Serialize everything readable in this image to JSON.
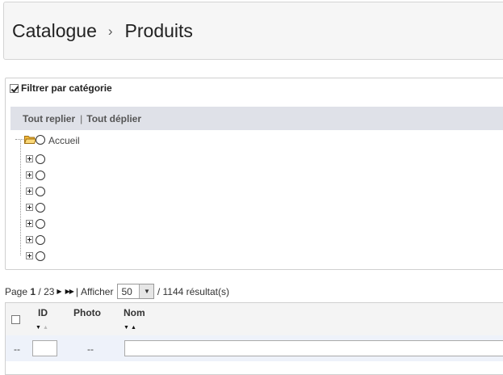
{
  "breadcrumb": {
    "items": [
      "Catalogue",
      "Produits"
    ],
    "separator": "›"
  },
  "filter": {
    "checkbox_label": "Filtrer par catégorie",
    "checked": true,
    "collapse_all": "Tout replier",
    "separator": "|",
    "expand_all": "Tout déplier",
    "tree": {
      "root_label": "Accueil",
      "child_count": 7
    }
  },
  "pagination": {
    "page_prefix": "Page",
    "current_page": "1",
    "total_pages": "/ 23",
    "separator": "|",
    "show_label": "Afficher",
    "per_page": "50",
    "results": "/ 1144 résultat(s)"
  },
  "table": {
    "columns": [
      {
        "label": "ID",
        "sortable": true
      },
      {
        "label": "Photo",
        "sortable": false
      },
      {
        "label": "Nom",
        "sortable": true
      }
    ],
    "filter_row": {
      "placeholder_dash": "--",
      "photo_dash": "--"
    }
  },
  "colors": {
    "toolbar_bg": "#dfe1e8",
    "header_bg": "#f6f6f6",
    "filter_row_bg": "#eef2fa",
    "folder": "#f1b83d"
  }
}
